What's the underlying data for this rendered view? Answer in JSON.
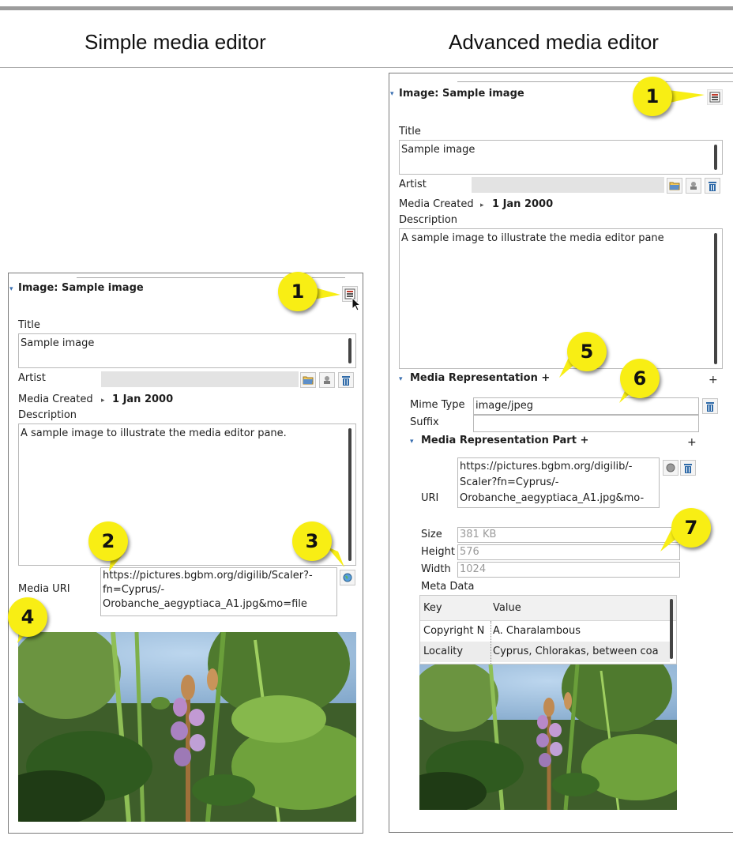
{
  "headers": {
    "simple": "Simple media editor",
    "advanced": "Advanced media editor"
  },
  "simple": {
    "section_title": "Image: Sample image",
    "title_label": "Title",
    "title_value": "Sample image",
    "artist_label": "Artist",
    "media_created_label": "Media Created",
    "media_created_value": "1 Jan 2000",
    "description_label": "Description",
    "description_value": "A sample image to illustrate the media editor pane.",
    "media_uri_label": "Media URI",
    "media_uri_lines": [
      "https://pictures.bgbm.org/digilib/Scaler?-",
      "fn=Cyprus/-",
      "Orobanche_aegyptiaca_A1.jpg&mo=file"
    ]
  },
  "advanced": {
    "section_title": "Image: Sample image",
    "title_label": "Title",
    "title_value": "Sample image",
    "artist_label": "Artist",
    "media_created_label": "Media Created",
    "media_created_value": "1 Jan 2000",
    "description_label": "Description",
    "description_value": "A sample image to illustrate the media editor pane",
    "representation_title": "Media Representation +",
    "mime_type_label": "Mime Type",
    "mime_type_value": "image/jpeg",
    "suffix_label": "Suffix",
    "suffix_value": "",
    "part_title": "Media Representation Part +",
    "uri_label": "URI",
    "uri_lines": [
      "https://pictures.bgbm.org/digilib/-",
      "Scaler?fn=Cyprus/-",
      "Orobanche_aegyptiaca_A1.jpg&mo-"
    ],
    "size_label": "Size",
    "size_value": "381 KB",
    "height_label": "Height",
    "height_value": "576",
    "width_label": "Width",
    "width_value": "1024",
    "meta_label": "Meta Data",
    "meta_columns": [
      "Key",
      "Value"
    ],
    "meta_rows": [
      {
        "key": "Copyright N",
        "value": "A. Charalambous"
      },
      {
        "key": "Locality",
        "value": "Cyprus, Chlorakas, between coa"
      }
    ],
    "plus_symbol": "+"
  },
  "badges": [
    "1",
    "2",
    "3",
    "4",
    "1",
    "5",
    "6",
    "7"
  ],
  "icons": {
    "editor_toggle": "editor-toggle-icon",
    "folder": "folder-icon",
    "stamp": "stamp-icon",
    "trash": "trash-icon",
    "globe": "globe-icon",
    "cursor": "mouse-pointer-icon"
  },
  "colors": {
    "badge": "#f8ee14",
    "accent_caret": "#3a6fb0",
    "trash_blue": "#2f6aa8"
  }
}
